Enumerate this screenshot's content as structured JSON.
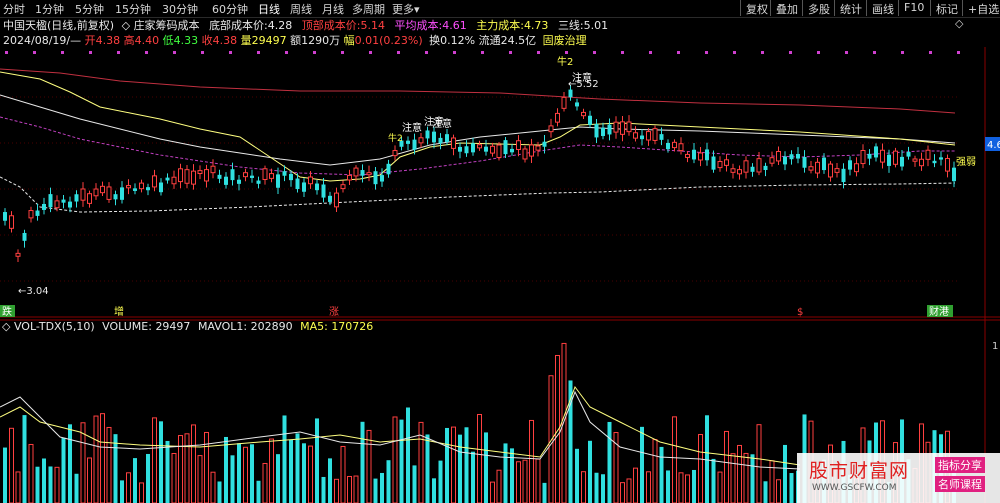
{
  "toolbar": {
    "periods": [
      "分时",
      "1分钟",
      "5分钟",
      "15分钟",
      "30分钟",
      "60分钟",
      "日线",
      "周线",
      "月线",
      "多周期",
      "更多"
    ],
    "active_period": "日线",
    "more_arrow": "▾",
    "buttons": [
      "复权",
      "叠加",
      "多股",
      "统计",
      "画线",
      "F10",
      "标记",
      "+自选"
    ],
    "adjust_icons": "◇",
    "expand_icon": "◇"
  },
  "header": {
    "stock_name": "中国天楹(日线,前复权)",
    "indicator_name": "庄家筹码成本",
    "bottom_cost_label": "底部成本价:",
    "bottom_cost_value": "4.28",
    "top_cost_label": "顶部成本价:",
    "top_cost_value": "5.14",
    "avg_cost_label": "平均成本:",
    "avg_cost_value": "4.61",
    "main_cost_label": "主力成本:",
    "main_cost_value": "4.73",
    "three_line_label": "三线:",
    "three_line_value": "5.01"
  },
  "quote": {
    "date": "2024/08/19/—",
    "open_label": "开",
    "open": "4.38",
    "high_label": "高",
    "high": "4.40",
    "low_label": "低",
    "low": "4.33",
    "close_label": "收",
    "close": "4.38",
    "vol_label": "量",
    "vol": "29497",
    "amount_label": "额",
    "amount": "1290万",
    "change_label": "幅",
    "change": "0.01(0.23%)",
    "turnover_label": "换",
    "turnover": "0.12%",
    "float_label": "流通",
    "float": "24.5亿",
    "concept": "固废治理"
  },
  "main_chart": {
    "low_marker": "3.04",
    "high_marker": "5.52",
    "right_price": "4.6",
    "annotations": [
      "注意",
      "注意",
      "注意",
      "注意",
      "牛2",
      "牛2"
    ],
    "strength_label": "强弱",
    "bottom_labels": [
      "跌",
      "增",
      "涨",
      "$",
      "财港"
    ],
    "colors": {
      "up": "#ff4040",
      "down": "#30e0e0",
      "ma_white": "#e8e8e8",
      "ma_yellow": "#ffff80",
      "ma_purple": "#c040c0",
      "ma_red": "#c03040"
    }
  },
  "volume": {
    "indicator": "VOL-TDX(5,10)",
    "volume_label": "VOLUME:",
    "volume_value": "29497",
    "mavol1_label": "MAVOL1:",
    "mavol1_value": "202890",
    "ma5_label": "MA5:",
    "ma5_value": "170726",
    "right_scale": "1"
  },
  "watermark": {
    "title": "股市财富网",
    "url": "WWW.GSCFW.COM",
    "tag1": "指标分享",
    "tag2": "名师课程"
  }
}
